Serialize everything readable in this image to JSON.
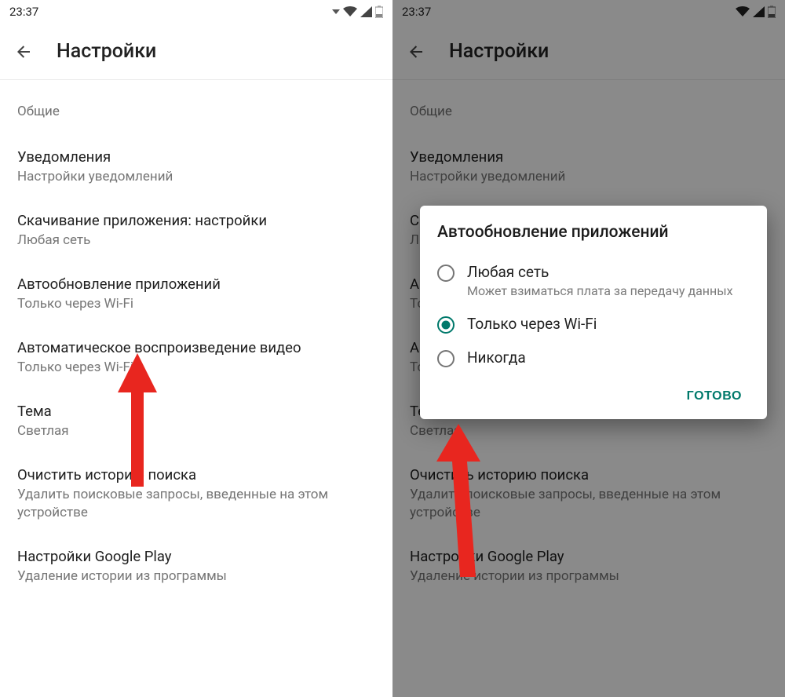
{
  "status": {
    "time": "23:37"
  },
  "header": {
    "title": "Настройки"
  },
  "section": {
    "general": "Общие"
  },
  "prefs": {
    "notifications": {
      "title": "Уведомления",
      "subtitle": "Настройки уведомлений"
    },
    "download": {
      "title": "Скачивание приложения: настройки",
      "subtitle": "Любая сеть"
    },
    "autoupdate": {
      "title": "Автообновление приложений",
      "subtitle": "Только через Wi-Fi"
    },
    "autoplay": {
      "title": "Автоматическое воспроизведение видео",
      "subtitle": "Только через Wi-Fi"
    },
    "theme": {
      "title": "Тема",
      "subtitle": "Светлая"
    },
    "clearhistory": {
      "title": "Очистить историю поиска",
      "subtitle": "Удалить поисковые запросы, введенные на этом устройстве"
    },
    "playsettings": {
      "title": "Настройки Google Play",
      "subtitle": "Удаление истории из программы"
    }
  },
  "dialog": {
    "title": "Автообновление приложений",
    "options": {
      "any": {
        "label": "Любая сеть",
        "desc": "Может взиматься плата за передачу данных"
      },
      "wifi": {
        "label": "Только через Wi-Fi"
      },
      "never": {
        "label": "Никогда"
      }
    },
    "done": "ГОТОВО"
  }
}
